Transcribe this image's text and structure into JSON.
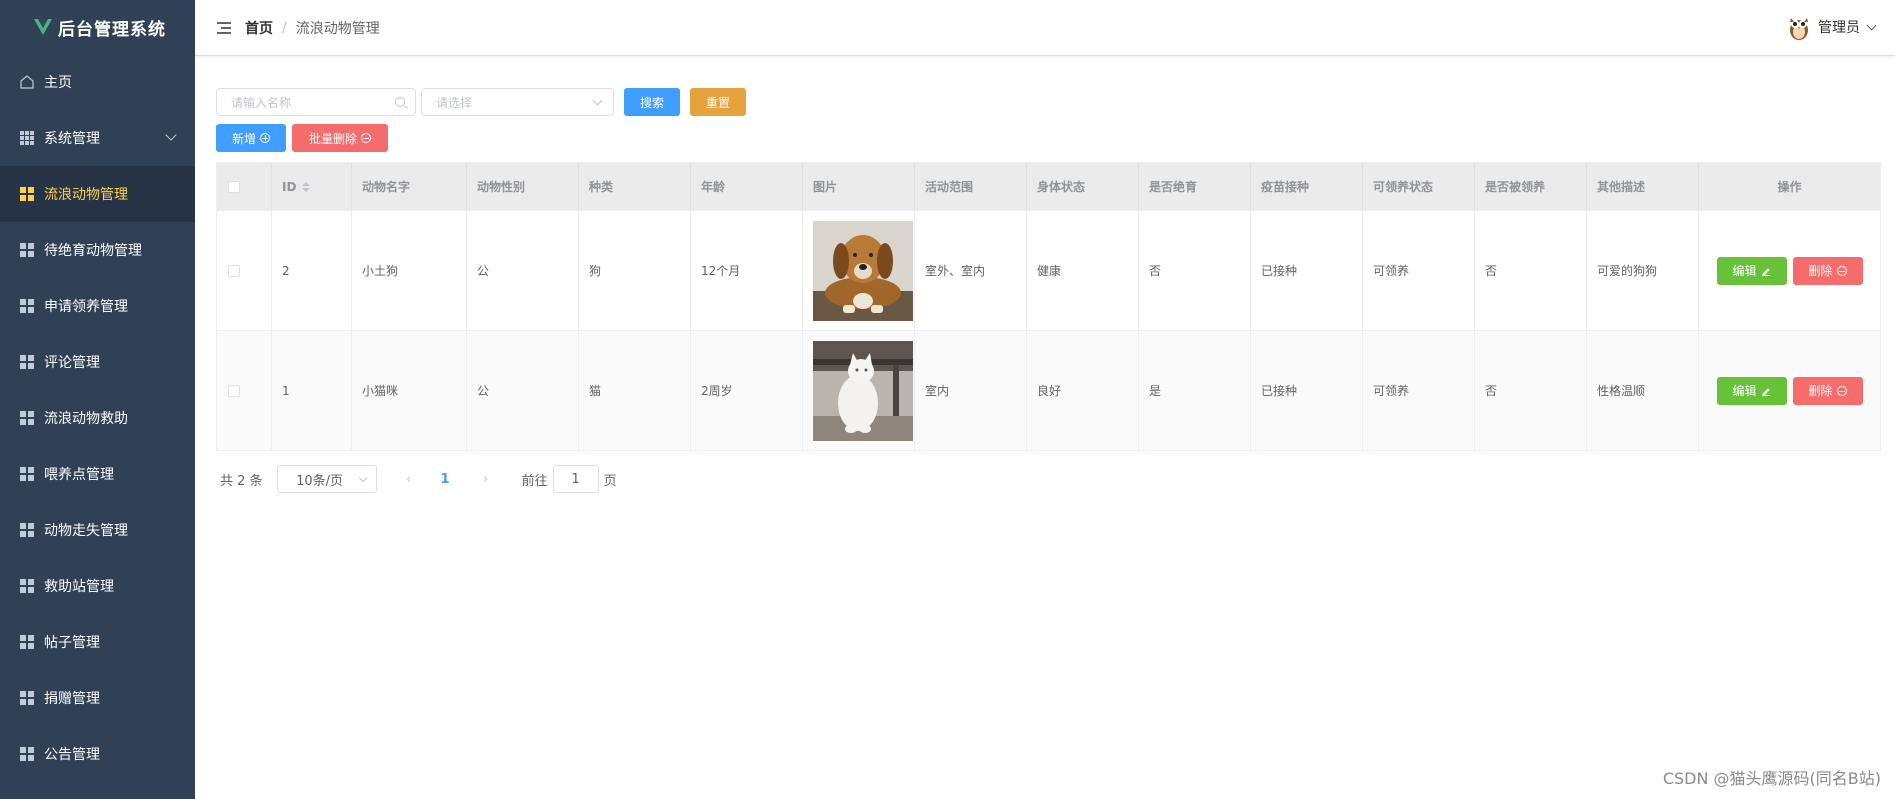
{
  "app": {
    "title": "后台管理系统",
    "brand_color": "#41b883"
  },
  "sidebar": {
    "items": [
      {
        "label": "主页",
        "icon": "home-icon"
      },
      {
        "label": "系统管理",
        "icon": "grid-icon",
        "expandable": true
      },
      {
        "label": "流浪动物管理",
        "icon": "grid-icon",
        "active": true
      },
      {
        "label": "待绝育动物管理",
        "icon": "grid-icon"
      },
      {
        "label": "申请领养管理",
        "icon": "grid-icon"
      },
      {
        "label": "评论管理",
        "icon": "grid-icon"
      },
      {
        "label": "流浪动物救助",
        "icon": "grid-icon"
      },
      {
        "label": "喂养点管理",
        "icon": "grid-icon"
      },
      {
        "label": "动物走失管理",
        "icon": "grid-icon"
      },
      {
        "label": "救助站管理",
        "icon": "grid-icon"
      },
      {
        "label": "帖子管理",
        "icon": "grid-icon"
      },
      {
        "label": "捐赠管理",
        "icon": "grid-icon"
      },
      {
        "label": "公告管理",
        "icon": "grid-icon"
      }
    ]
  },
  "header": {
    "breadcrumb": {
      "home": "首页",
      "separator": "/",
      "current": "流浪动物管理"
    },
    "user": {
      "name": "管理员"
    }
  },
  "toolbar": {
    "search_placeholder": "请输入名称",
    "select_placeholder": "请选择",
    "search_label": "搜索",
    "reset_label": "重置",
    "add_label": "新增",
    "batch_delete_label": "批量删除"
  },
  "table": {
    "columns": [
      "ID",
      "动物名字",
      "动物性别",
      "种类",
      "年龄",
      "图片",
      "活动范围",
      "身体状态",
      "是否绝育",
      "疫苗接种",
      "可领养状态",
      "是否被领养",
      "其他描述",
      "操作"
    ],
    "rows": [
      {
        "id": "2",
        "name": "小土狗",
        "gender": "公",
        "species": "狗",
        "age": "12个月",
        "photo": "dog-photo",
        "range": "室外、室内",
        "health": "健康",
        "neutered": "否",
        "vaccine": "已接种",
        "adoptable": "可领养",
        "adopted": "否",
        "desc": "可爱的狗狗"
      },
      {
        "id": "1",
        "name": "小猫咪",
        "gender": "公",
        "species": "猫",
        "age": "2周岁",
        "photo": "cat-photo",
        "range": "室内",
        "health": "良好",
        "neutered": "是",
        "vaccine": "已接种",
        "adoptable": "可领养",
        "adopted": "否",
        "desc": "性格温顺"
      }
    ],
    "edit_label": "编辑",
    "delete_label": "删除"
  },
  "pagination": {
    "total_text": "共 2 条",
    "page_size": "10条/页",
    "current_page": "1",
    "goto_label": "前往",
    "goto_value": "1",
    "page_suffix": "页"
  },
  "watermark": "CSDN @猫头鹰源码(同名B站)"
}
